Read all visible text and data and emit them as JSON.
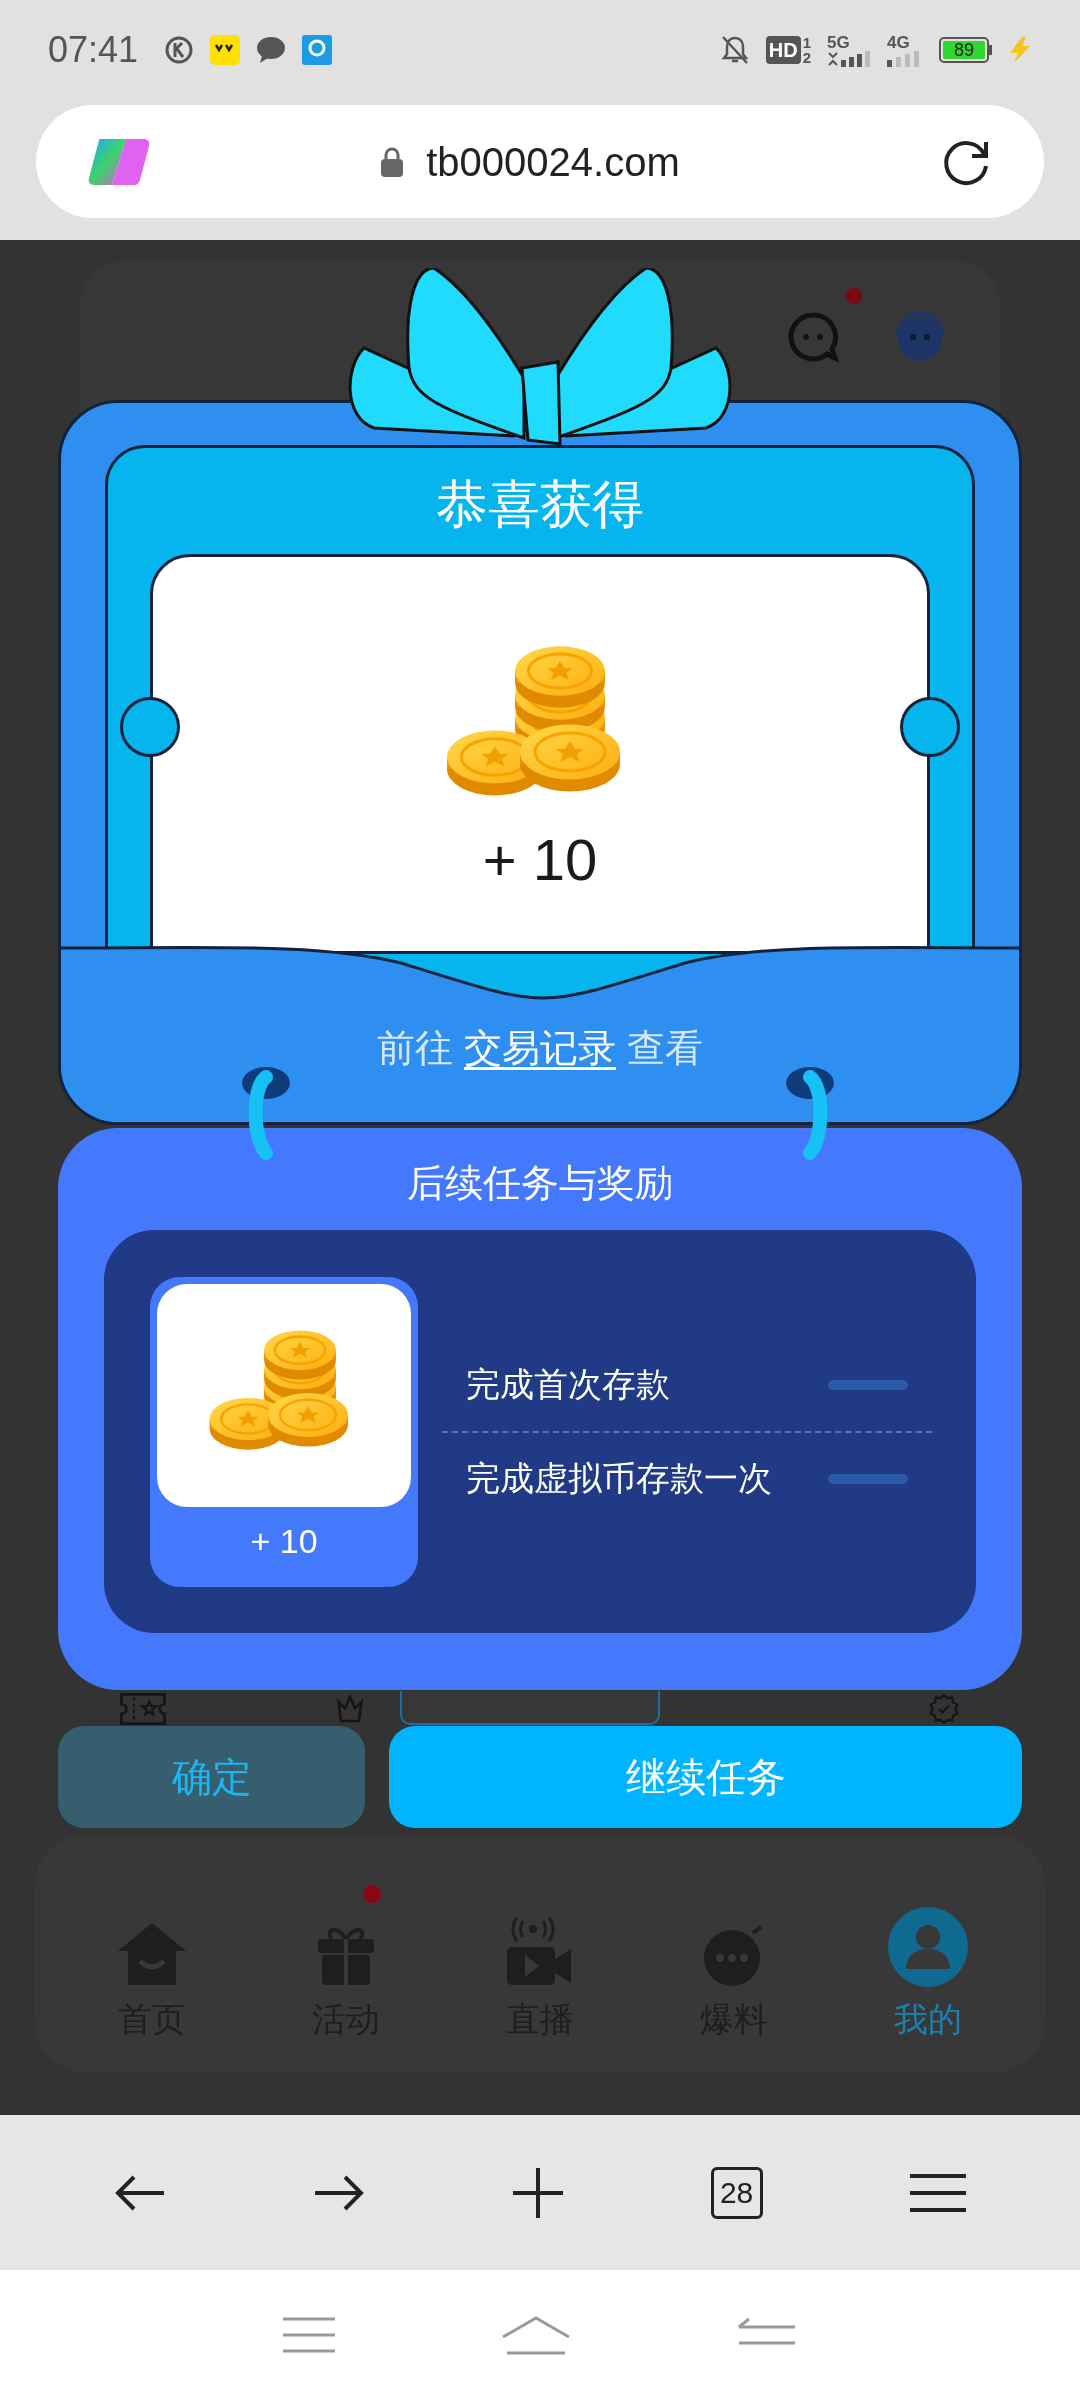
{
  "status_bar": {
    "time": "07:41",
    "hd": "HD",
    "sim_numbers": [
      "1",
      "2"
    ],
    "network_5g": "5G",
    "network_4g": "4G",
    "battery": "89"
  },
  "address_bar": {
    "url": "tb000024.com"
  },
  "page": {
    "header_badge": true,
    "bottom_nav": [
      {
        "label": "首页",
        "selected": false,
        "badge": false
      },
      {
        "label": "活动",
        "selected": false,
        "badge": true
      },
      {
        "label": "直播",
        "selected": false,
        "badge": false
      },
      {
        "label": "爆料",
        "selected": false,
        "badge": false
      },
      {
        "label": "我的",
        "selected": true,
        "badge": false
      }
    ]
  },
  "reward_dialog": {
    "title": "恭喜获得",
    "amount": "+ 10",
    "link_prefix": "前往 ",
    "link": "交易记录",
    "link_suffix": " 查看",
    "followup_title": "后续任务与奖励",
    "followup_reward": "+ 10",
    "tasks": [
      {
        "label": "完成首次存款"
      },
      {
        "label": "完成虚拟币存款一次"
      }
    ],
    "buttons": [
      {
        "label": "确定",
        "kind": "secondary"
      },
      {
        "label": "继续任务",
        "kind": "primary"
      }
    ]
  },
  "browser_toolbar": {
    "tab_count": "28"
  }
}
